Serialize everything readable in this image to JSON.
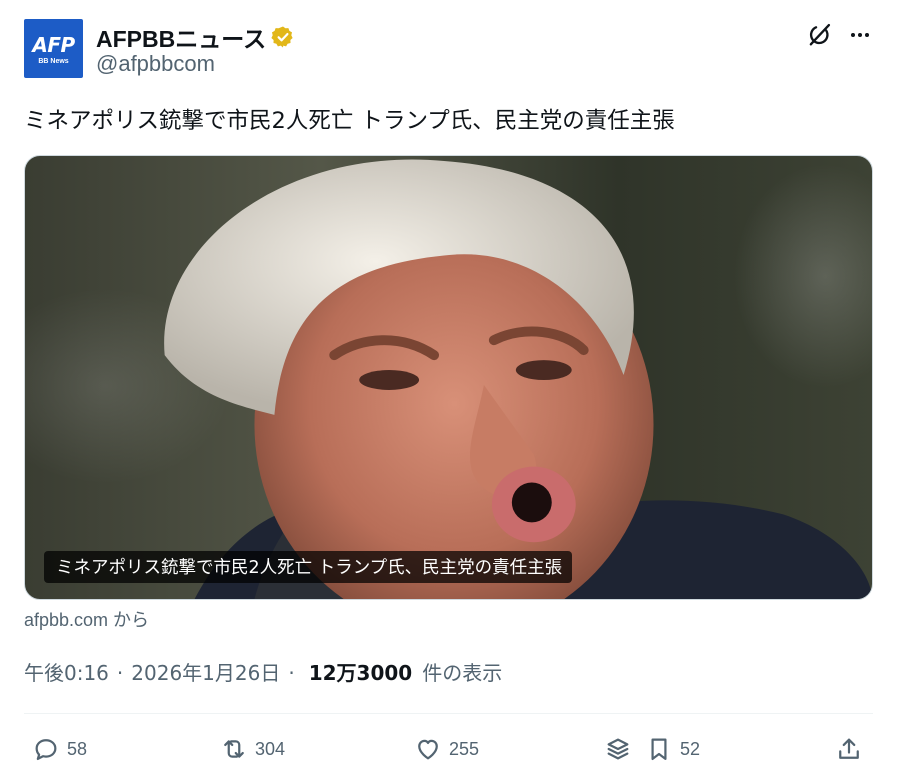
{
  "author": {
    "display_name": "AFPBBニュース",
    "handle": "@afpbbcom",
    "avatar_text": "AFP",
    "avatar_subtext": "BB News",
    "verified": true,
    "verified_color": "#e2b719",
    "avatar_color": "#1d5cc6"
  },
  "header_actions": {
    "grok_icon": "grok-icon",
    "more_icon": "more-icon"
  },
  "tweet": {
    "text": "ミネアポリス銃撃で市民2人死亡 トランプ氏、民主党の責任主張"
  },
  "media": {
    "caption": "ミネアポリス銃撃で市民2人死亡 トランプ氏、民主党の責任主張"
  },
  "source": {
    "label": "afpbb.com から"
  },
  "meta": {
    "time": "午後0:16",
    "date": "2026年1月26日",
    "separator": "·",
    "views_count": "12万3000",
    "views_label": "件の表示"
  },
  "actions": {
    "replies": "58",
    "reposts": "304",
    "likes": "255",
    "bookmarks": "52"
  },
  "colors": {
    "secondary_text": "#536471",
    "primary_text": "#0f1419",
    "border": "#cfd9de"
  }
}
